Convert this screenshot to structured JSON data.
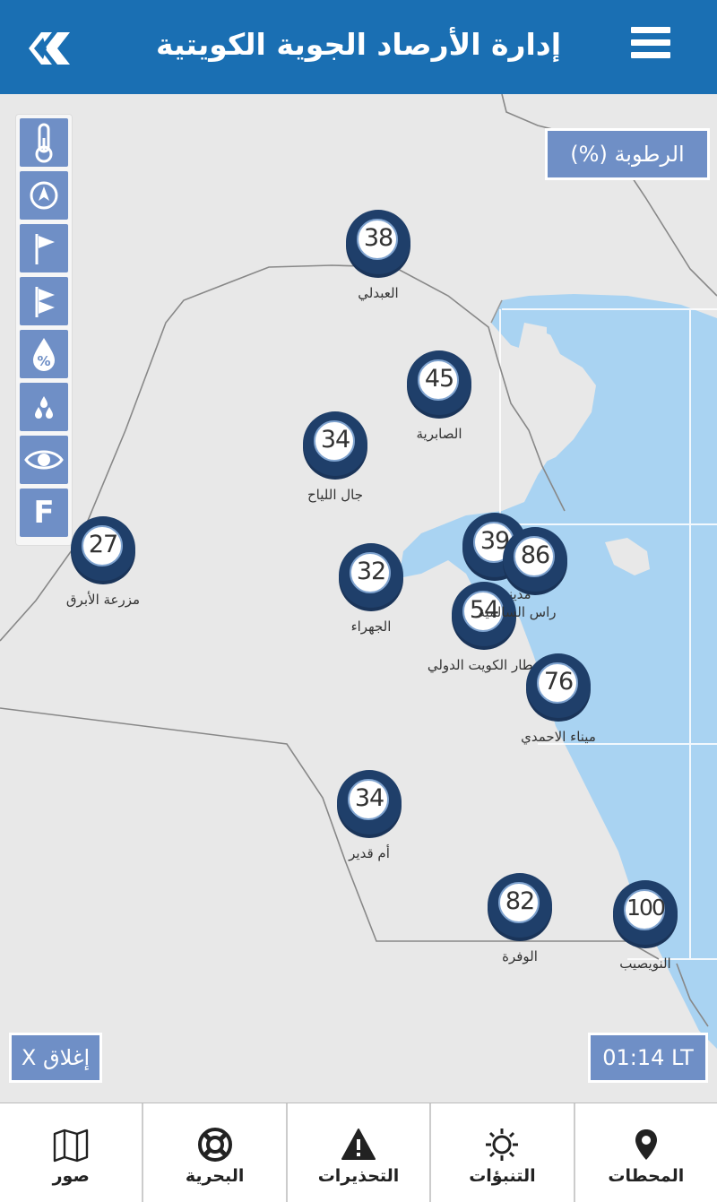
{
  "header": {
    "title": "إدارة الأرصاد الجوية الكويتية"
  },
  "overlay": {
    "parameter": "الرطوبة (%)",
    "close": "X إغلاق",
    "time": "01:14 LT"
  },
  "tools": [
    {
      "icon": "thermometer-icon"
    },
    {
      "icon": "compass-icon"
    },
    {
      "icon": "flag-icon"
    },
    {
      "icon": "wind-flag-icon"
    },
    {
      "icon": "humidity-drop-icon"
    },
    {
      "icon": "rain-drops-icon"
    },
    {
      "icon": "eye-icon"
    },
    {
      "icon": "fahrenheit-icon",
      "label": "F"
    }
  ],
  "stations": [
    {
      "value": "38",
      "name": "العبدلي"
    },
    {
      "value": "45",
      "name": "الصابرية"
    },
    {
      "value": "34",
      "name": "جال اللياح"
    },
    {
      "value": "27",
      "name": "مزرعة الأبرق"
    },
    {
      "value": "32",
      "name": "الجهراء"
    },
    {
      "value": "39",
      "name": "مدينة الكويت"
    },
    {
      "value": "86",
      "name": "راس السالمية"
    },
    {
      "value": "54",
      "name": "مطار الكويت الدولي"
    },
    {
      "value": "76",
      "name": "ميناء الاحمدي"
    },
    {
      "value": "34",
      "name": "أم قدير"
    },
    {
      "value": "82",
      "name": "الوفرة"
    },
    {
      "value": "100",
      "name": "النويصيب"
    }
  ],
  "tabs": [
    {
      "label": "صور",
      "icon": "map-icon"
    },
    {
      "label": "البحرية",
      "icon": "lifebuoy-icon"
    },
    {
      "label": "التحذيرات",
      "icon": "warning-icon"
    },
    {
      "label": "التنبؤات",
      "icon": "sun-icon"
    },
    {
      "label": "المحطات",
      "icon": "location-pin-icon"
    }
  ],
  "colors": {
    "header": "#1a6fb3",
    "sea": "#a9d3f2",
    "land": "#e8e8e8",
    "button": "#6f8fc6",
    "marker": "#1f3f6a"
  }
}
